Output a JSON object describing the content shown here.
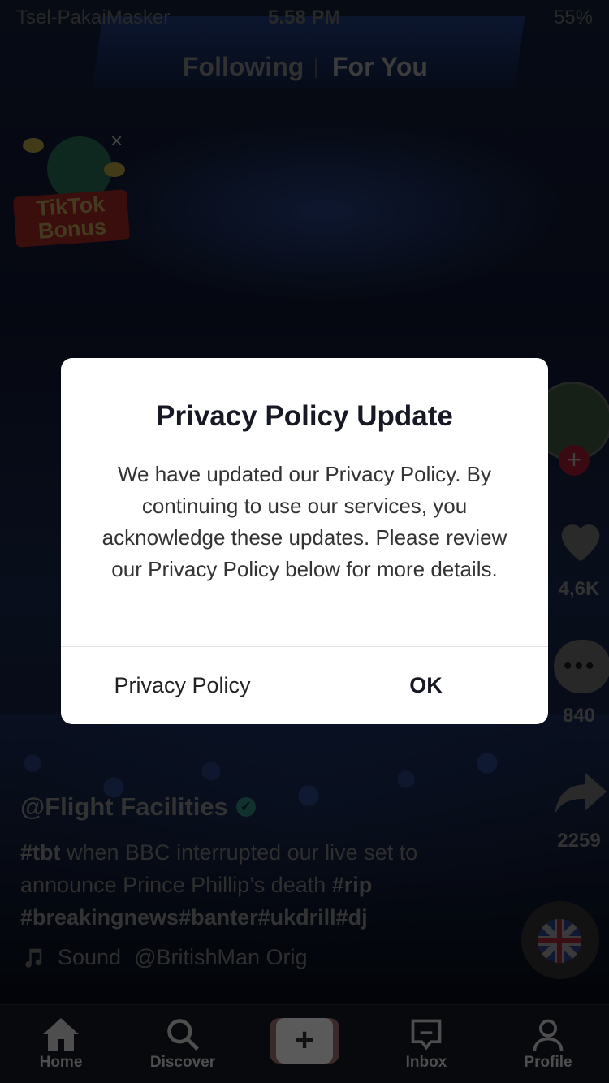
{
  "status_bar": {
    "carrier": "Tsel-PakaiMasker",
    "time": "5.58 PM",
    "battery": "55%"
  },
  "top_tabs": {
    "following": "Following",
    "for_you": "For You"
  },
  "bonus": {
    "line1": "TikTok",
    "line2": "Bonus",
    "close": "×"
  },
  "right_rail": {
    "likes": "4,6K",
    "comments": "840",
    "shares": "2259",
    "follow_plus": "+"
  },
  "caption": {
    "username": "@Flight Facilities",
    "verified_mark": "✓",
    "hashtag_tbt": "#tbt",
    "text_part1": " when BBC interrupted our live set to announce Prince Phillip’s death ",
    "hashtag_rip": "#rip",
    "hashtags_line": "#breakingnews#banter#ukdrill#dj",
    "sound_label": "Sound",
    "sound_author": "@BritishMan Orig"
  },
  "bottom_nav": {
    "home": "Home",
    "discover": "Discover",
    "create": "+",
    "inbox": "Inbox",
    "profile": "Profile"
  },
  "dialog": {
    "title": "Privacy Policy Update",
    "body": "We have updated our Privacy Policy. By continuing to use our services, you acknowledge these updates. Please review our Privacy Policy below for more details.",
    "privacy_button": "Privacy Policy",
    "ok_button": "OK"
  },
  "colors": {
    "dialog_bg": "#ffffff",
    "title_text": "#161823",
    "overlay": "rgba(0,0,0,0.45)"
  }
}
